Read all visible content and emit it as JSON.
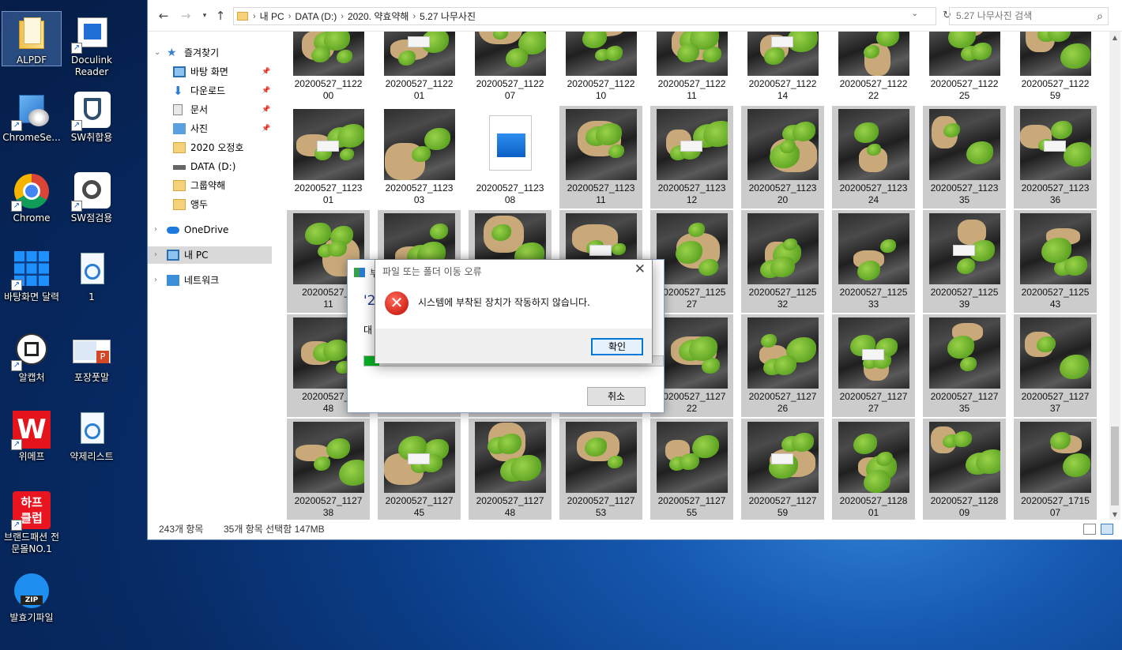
{
  "desktop": {
    "icons": [
      {
        "label": "ALPDF",
        "icon": "folder-icon"
      },
      {
        "label": "Doculink Reader",
        "icon": "doculink-icon"
      },
      {
        "label": "ChromeSe...",
        "icon": "chrome-setup-icon"
      },
      {
        "label": "SW취합용",
        "icon": "shield-icon"
      },
      {
        "label": "Chrome",
        "icon": "chrome-icon"
      },
      {
        "label": "SW점검용",
        "icon": "scan-icon"
      },
      {
        "label": "바탕화면 달력",
        "icon": "calendar-tiles-icon"
      },
      {
        "label": "1",
        "icon": "hwp-document-icon"
      },
      {
        "label": "알캡처",
        "icon": "alcapture-icon"
      },
      {
        "label": "포장풋말",
        "icon": "powerpoint-icon"
      },
      {
        "label": "위메프",
        "icon": "wemakeprice-icon"
      },
      {
        "label": "약제리스트",
        "icon": "hwp-document-icon"
      },
      {
        "label": "브랜드패션 전문몰NO.1",
        "icon": "halfclub-icon",
        "logo_text": "하프 클럽"
      },
      {
        "label": "발효기파일",
        "icon": "zip-icon",
        "logo_text": "ZIP"
      }
    ]
  },
  "explorer": {
    "breadcrumb": [
      "내 PC",
      "DATA (D:)",
      "2020. 약효약해",
      "5.27 나무사진"
    ],
    "search_placeholder": "5.27 나무사진 검색",
    "nav": [
      {
        "label": "즐겨찾기",
        "icon": "star-icon"
      },
      {
        "label": "바탕 화면",
        "icon": "desktop-icon"
      },
      {
        "label": "다운로드",
        "icon": "download-icon"
      },
      {
        "label": "문서",
        "icon": "document-icon"
      },
      {
        "label": "사진",
        "icon": "pictures-icon"
      },
      {
        "label": "2020 오정호",
        "icon": "folder-icon"
      },
      {
        "label": "DATA (D:)",
        "icon": "drive-icon"
      },
      {
        "label": "그룹약해",
        "icon": "folder-icon"
      },
      {
        "label": "앵두",
        "icon": "folder-icon"
      },
      {
        "label": "OneDrive",
        "icon": "cloud-icon"
      },
      {
        "label": "내 PC",
        "icon": "pc-icon"
      },
      {
        "label": "네트워크",
        "icon": "network-icon"
      }
    ],
    "files": [
      {
        "l1": "20200527_1122",
        "l2": "00",
        "sel": false
      },
      {
        "l1": "20200527_1122",
        "l2": "01",
        "sel": false
      },
      {
        "l1": "20200527_1122",
        "l2": "07",
        "sel": false
      },
      {
        "l1": "20200527_1122",
        "l2": "10",
        "sel": false
      },
      {
        "l1": "20200527_1122",
        "l2": "11",
        "sel": false
      },
      {
        "l1": "20200527_1122",
        "l2": "14",
        "sel": false
      },
      {
        "l1": "20200527_1122",
        "l2": "22",
        "sel": false
      },
      {
        "l1": "20200527_1122",
        "l2": "25",
        "sel": false
      },
      {
        "l1": "20200527_1122",
        "l2": "59",
        "sel": false
      },
      {
        "l1": "20200527_1123",
        "l2": "01",
        "sel": false
      },
      {
        "l1": "20200527_1123",
        "l2": "03",
        "sel": false
      },
      {
        "l1": "20200527_1123",
        "l2": "08",
        "sel": false,
        "doc": true
      },
      {
        "l1": "20200527_1123",
        "l2": "11",
        "sel": true
      },
      {
        "l1": "20200527_1123",
        "l2": "12",
        "sel": true
      },
      {
        "l1": "20200527_1123",
        "l2": "20",
        "sel": true
      },
      {
        "l1": "20200527_1123",
        "l2": "24",
        "sel": true
      },
      {
        "l1": "20200527_1123",
        "l2": "35",
        "sel": true
      },
      {
        "l1": "20200527_1123",
        "l2": "36",
        "sel": true
      },
      {
        "l1": "20200527_1",
        "l2": "11",
        "sel": true
      },
      {
        "l1": "",
        "l2": "",
        "sel": true
      },
      {
        "l1": "",
        "l2": "",
        "sel": true
      },
      {
        "l1": "",
        "l2": "",
        "sel": true
      },
      {
        "l1": "20200527_1125",
        "l2": "27",
        "sel": true
      },
      {
        "l1": "20200527_1125",
        "l2": "32",
        "sel": true
      },
      {
        "l1": "20200527_1125",
        "l2": "33",
        "sel": true
      },
      {
        "l1": "20200527_1125",
        "l2": "39",
        "sel": true
      },
      {
        "l1": "20200527_1125",
        "l2": "43",
        "sel": true
      },
      {
        "l1": "20200527_1",
        "l2": "48",
        "sel": true
      },
      {
        "l1": "",
        "l2": "",
        "sel": true
      },
      {
        "l1": "",
        "l2": "",
        "sel": true
      },
      {
        "l1": "",
        "l2": "",
        "sel": true
      },
      {
        "l1": "20200527_1127",
        "l2": "22",
        "sel": true
      },
      {
        "l1": "20200527_1127",
        "l2": "26",
        "sel": true
      },
      {
        "l1": "20200527_1127",
        "l2": "27",
        "sel": true
      },
      {
        "l1": "20200527_1127",
        "l2": "35",
        "sel": true
      },
      {
        "l1": "20200527_1127",
        "l2": "37",
        "sel": true
      },
      {
        "l1": "20200527_1127",
        "l2": "38",
        "sel": true
      },
      {
        "l1": "20200527_1127",
        "l2": "45",
        "sel": true
      },
      {
        "l1": "20200527_1127",
        "l2": "48",
        "sel": true
      },
      {
        "l1": "20200527_1127",
        "l2": "53",
        "sel": true
      },
      {
        "l1": "20200527_1127",
        "l2": "55",
        "sel": true
      },
      {
        "l1": "20200527_1127",
        "l2": "59",
        "sel": true
      },
      {
        "l1": "20200527_1128",
        "l2": "01",
        "sel": true
      },
      {
        "l1": "20200527_1128",
        "l2": "09",
        "sel": true
      },
      {
        "l1": "20200527_1715",
        "l2": "07",
        "sel": true
      }
    ],
    "status": {
      "count": "243개 항목",
      "selected": "35개 항목 선택함 147MB"
    }
  },
  "progress_dialog": {
    "title": "부",
    "big_text": "'2",
    "mid_text": "대",
    "progress": 0.05,
    "cancel_label": "취소"
  },
  "error_dialog": {
    "title": "파일 또는 폴더 이동 오류",
    "message": "시스템에 부착된 장치가 작동하지 않습니다.",
    "ok_label": "확인"
  }
}
